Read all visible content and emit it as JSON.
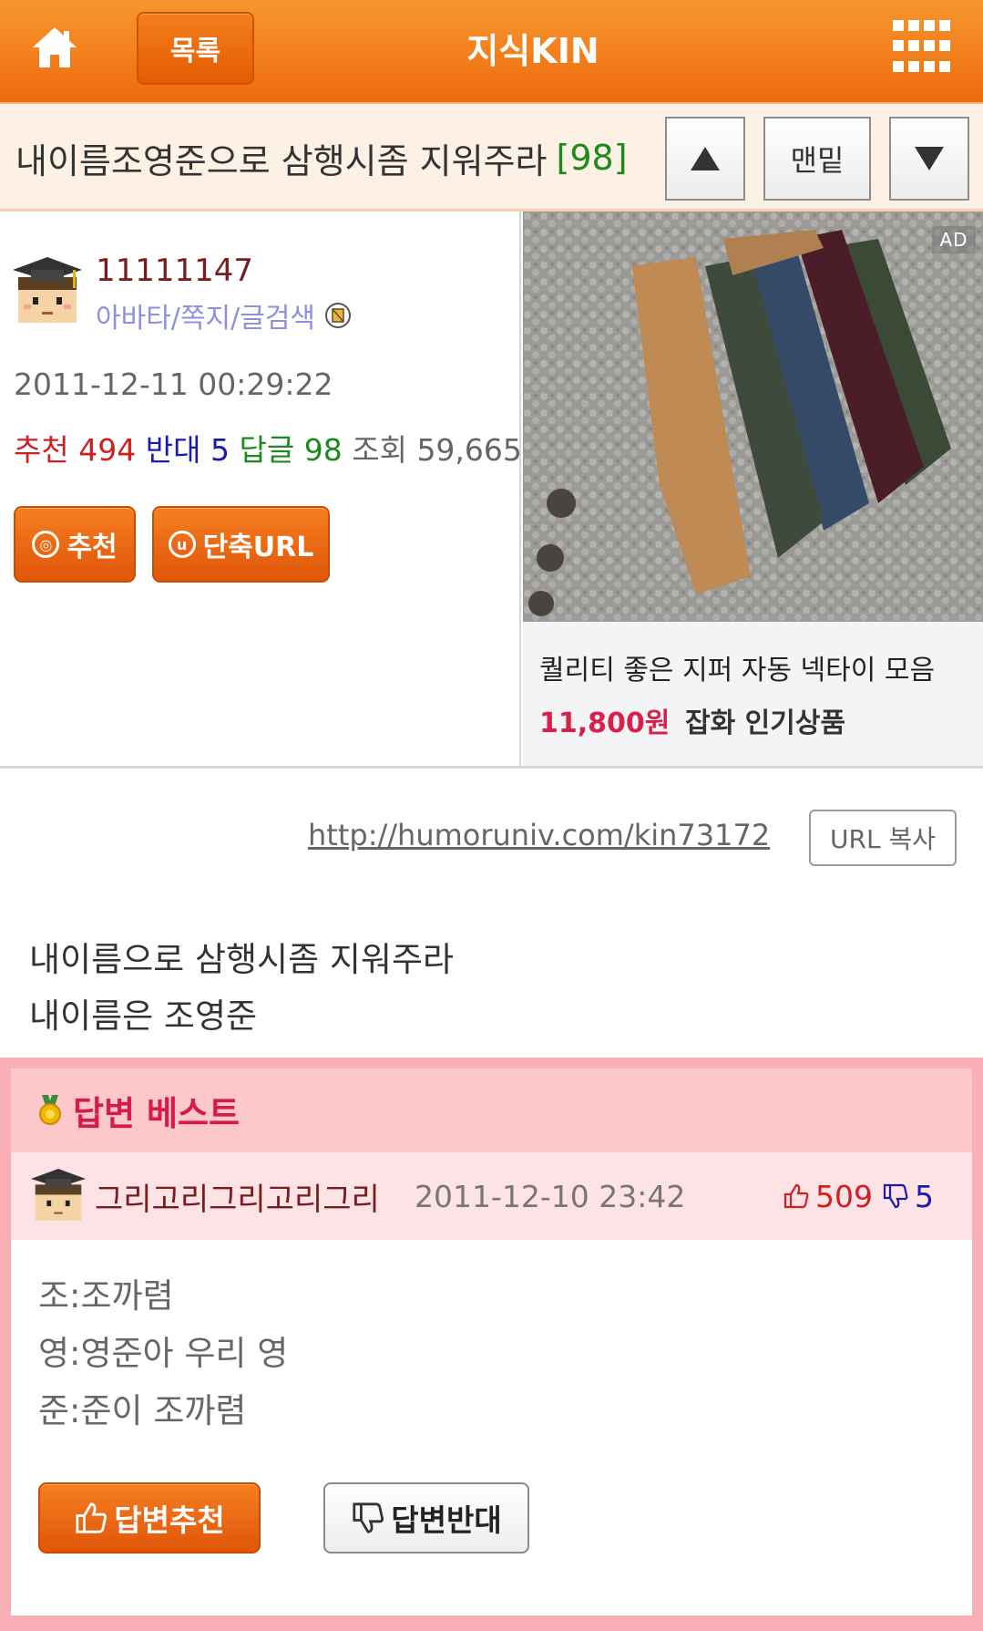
{
  "topbar": {
    "home_icon": "home-icon",
    "list_label": "목록",
    "app_title": "지식KIN",
    "menu_icon": "grid-menu-icon"
  },
  "post": {
    "title": "내이름조영준으로 삼행시좀 지워주라",
    "reply_count_label": "[98]",
    "nav_up_icon": "triangle-up-icon",
    "nav_bottom_label": "맨밑",
    "nav_down_icon": "triangle-down-icon",
    "author_id": "11111147",
    "author_links": "아바타/쪽지/글검색",
    "date": "2011-12-11 00:29:22",
    "stats": {
      "recommend_label": "추천",
      "recommend_value": "494",
      "oppose_label": "반대",
      "oppose_value": "5",
      "reply_label": "답글",
      "reply_value": "98",
      "view_label": "조회",
      "view_value": "59,665"
    },
    "recommend_button": "추천",
    "shorturl_button": "단축URL",
    "url": "http://humoruniv.com/kin73172",
    "url_copy_button": "URL 복사",
    "body_lines": [
      "내이름으로 삼행시좀 지워주라",
      "내이름은 조영준"
    ]
  },
  "ad": {
    "badge": "AD",
    "title": "퀄리티 좋은 지퍼 자동 넥타이 모음",
    "price": "11,800원",
    "category": "잡화 인기상품"
  },
  "best_answer": {
    "section_title": "답변 베스트",
    "medal_icon": "medal-icon",
    "author": "그리고리그리고리그리",
    "date": "2011-12-10 23:42",
    "upvotes": "509",
    "downvotes": "5",
    "lines": [
      "조:조까렴",
      "영:영준아 우리 영",
      "준:준이 조까렴"
    ],
    "recommend_button": "답변추천",
    "oppose_button": "답변반대"
  },
  "colors": {
    "brand_orange": "#ee6b0c",
    "recommend_red": "#d02020",
    "oppose_blue": "#1a1ab0",
    "reply_green": "#1c8a1c",
    "best_pink": "#f8b0b6",
    "best_title": "#d61b4c"
  }
}
